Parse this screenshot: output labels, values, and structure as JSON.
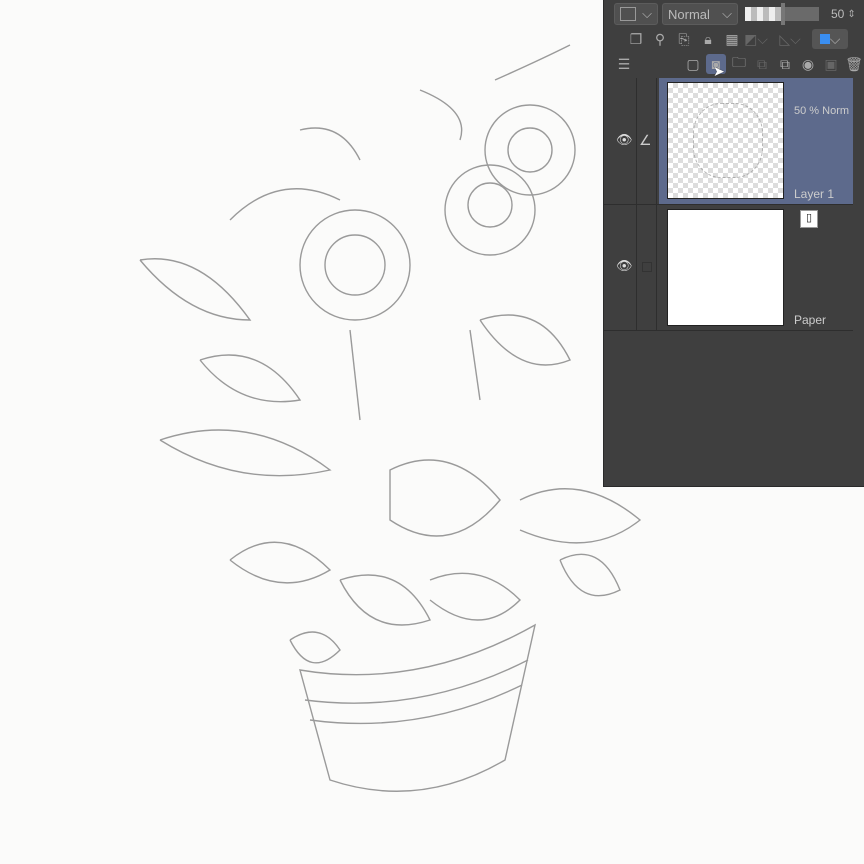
{
  "panel": {
    "blend_mode": "Normal",
    "opacity_value": "50",
    "opacity_percent": 50,
    "row2_icons": [
      "reference-layer-icon",
      "draft-layer-icon",
      "clip-to-layer-icon",
      "lock-icon",
      "lock-transparency-icon",
      "mask-icon",
      "ruler-icon",
      "layer-color-icon"
    ],
    "row3_icons": [
      "layer-list-icon",
      "new-raster-layer-icon",
      "new-vector-layer-icon",
      "new-folder-icon",
      "transfer-down-icon",
      "combine-icon",
      "layer-mask-icon",
      "mask-apply-icon",
      "delete-icon"
    ]
  },
  "layers": [
    {
      "name": "Layer 1",
      "info": "50 % Norm",
      "selected": true,
      "visible": true
    },
    {
      "name": "Paper",
      "visible": true,
      "selected": false
    }
  ],
  "colors": {
    "selected": "#5d6a8c",
    "panel": "#3f3f3f"
  }
}
